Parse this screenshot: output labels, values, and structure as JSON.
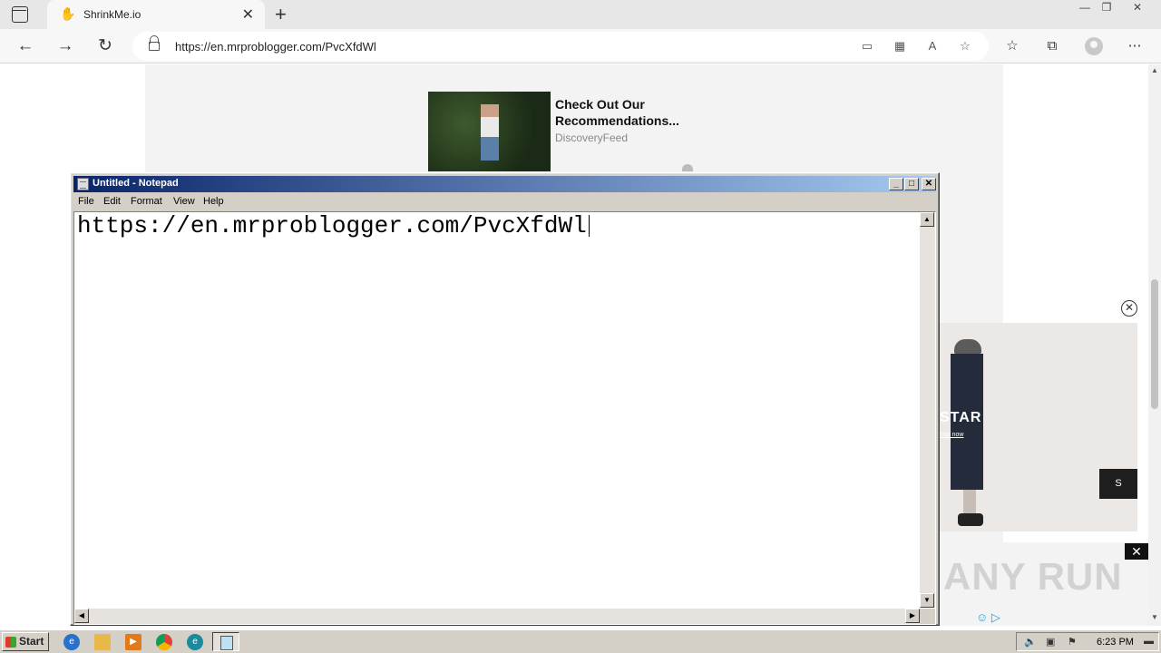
{
  "browser": {
    "tab_title": "ShrinkMe.io",
    "tab_close": "✕",
    "new_tab": "+",
    "address_url": "https://en.mrproblogger.com/PvcXfdWl",
    "window_controls": [
      "—",
      "❐",
      "✕"
    ],
    "icons": [
      "tab-actions-icon",
      "back-icon",
      "forward-icon",
      "refresh-icon",
      "lock-icon",
      "app-available-icon",
      "extensions-grid-icon",
      "read-aloud-icon",
      "add-favorite-icon",
      "favorites-icon",
      "collections-icon",
      "profile-icon",
      "more-icon"
    ]
  },
  "page": {
    "ad_card": {
      "headline": "Check Out Our Recommendations...",
      "source": "DiscoveryFeed"
    },
    "side_ad": {
      "brand": "STAR",
      "shop": "hop now",
      "next_label": "S"
    },
    "watermark": "ANY RUN"
  },
  "notepad": {
    "title": "Untitled - Notepad",
    "menu": [
      "File",
      "Edit",
      "Format",
      "View",
      "Help"
    ],
    "content": "https://en.mrproblogger.com/PvcXfdWl"
  },
  "taskbar": {
    "start_label": "Start",
    "clock": "6:23 PM"
  }
}
